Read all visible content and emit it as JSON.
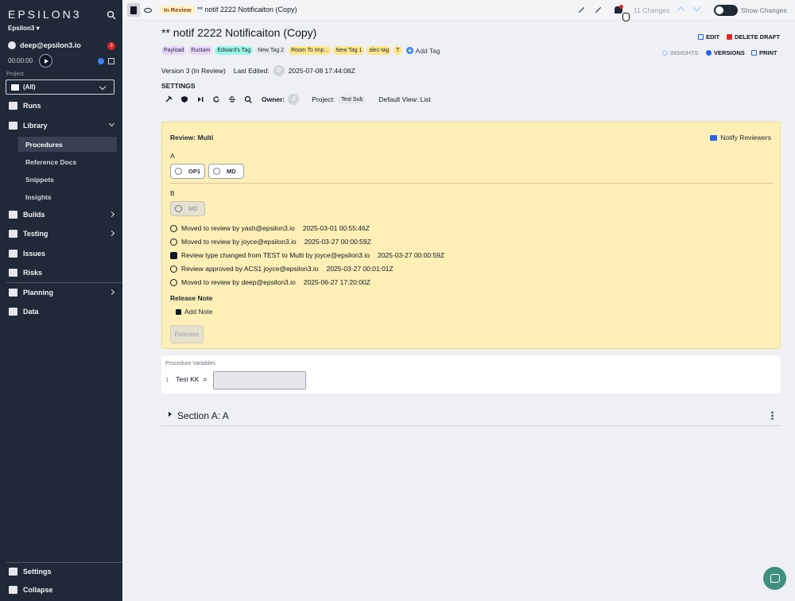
{
  "sidebar": {
    "logo": "EPSILON3",
    "workspace": "Epsilon3 ▾",
    "user": "deep@epsilon3.io",
    "notif_count": "3",
    "timer": "00:00:00",
    "project_label": "Project",
    "project_value": "(All)",
    "nav": [
      {
        "label": "Runs",
        "icon": "runs-icon"
      },
      {
        "label": "Library",
        "icon": "library-icon"
      },
      {
        "label": "Builds",
        "icon": "builds-icon"
      },
      {
        "label": "Testing",
        "icon": "testing-icon"
      },
      {
        "label": "Issues",
        "icon": "issues-icon"
      },
      {
        "label": "Risks",
        "icon": "risks-icon"
      },
      {
        "label": "Planning",
        "icon": "planning-icon"
      },
      {
        "label": "Data",
        "icon": "data-icon"
      }
    ],
    "library_sub": [
      "Procedures",
      "Reference Docs",
      "Snippets",
      "Insights"
    ],
    "footer": [
      "Settings",
      "Collapse"
    ]
  },
  "topbar": {
    "status": "In Review",
    "title": "** notif 2222 Notificaiton (Copy)",
    "changes": "11 Changes",
    "show_changes": "Show Changes"
  },
  "header": {
    "title": "** notif 2222 Notificaiton (Copy)",
    "actions": {
      "edit": "EDIT",
      "delete": "DELETE DRAFT",
      "insights": "INSIGHTS",
      "versions": "VERSIONS",
      "print": "PRINT"
    },
    "tags": [
      {
        "label": "Payload",
        "color": "#e9d5ff"
      },
      {
        "label": "Rustam",
        "color": "#e9d5ff"
      },
      {
        "label": "Edward's Tag",
        "color": "#99f6e4"
      },
      {
        "label": "New Tag 2",
        "color": "#e5e7eb"
      },
      {
        "label": "Room To Imp...",
        "color": "#fde68a"
      },
      {
        "label": "New Tag 1",
        "color": "#fde68a"
      },
      {
        "label": "alec-tag",
        "color": "#fde68a"
      },
      {
        "label": "T",
        "color": "#fde68a"
      }
    ],
    "add_tag": "Add Tag",
    "version": "Version 3 (In Review)",
    "last_edited_label": "Last Edited:",
    "last_edited_avatar": "D",
    "last_edited": "2025-07-08 17:44:08Z",
    "settings_label": "SETTINGS",
    "owner_label": "Owner:",
    "owner_avatar": "J",
    "project_label": "Project:",
    "project_value": "Test Sub",
    "default_view": "Default View: List"
  },
  "review": {
    "title": "Review: Multi",
    "notify": "Notify Reviewers",
    "group_a": "A",
    "group_a_chips": [
      "OP1",
      "MD"
    ],
    "group_b": "B",
    "group_b_chips": [
      "MD"
    ],
    "history": [
      {
        "text": "Moved to review by yash@epsilon3.io",
        "ts": "2025-03-01 00:55:46Z"
      },
      {
        "text": "Moved to review by joyce@epsilon3.io",
        "ts": "2025-03-27 00:00:59Z"
      },
      {
        "text": "Review type changed from TEST to Multi by joyce@epsilon3.io",
        "ts": "2025-03-27 00:00:59Z"
      },
      {
        "text": "Review approved by ACS1 joyce@epsilon3.io",
        "ts": "2025-03-27 00:01:01Z"
      },
      {
        "text": "Moved to review by deep@epsilon3.io",
        "ts": "2025-06-27 17:20:00Z"
      }
    ],
    "release_note": "Release Note",
    "add_note": "Add Note",
    "release": "Release"
  },
  "variables": {
    "header": "Procedure Variables",
    "rows": [
      {
        "num": "1",
        "name": "Test KK",
        "eq": "="
      }
    ]
  },
  "section": {
    "title": "Section A: A"
  }
}
